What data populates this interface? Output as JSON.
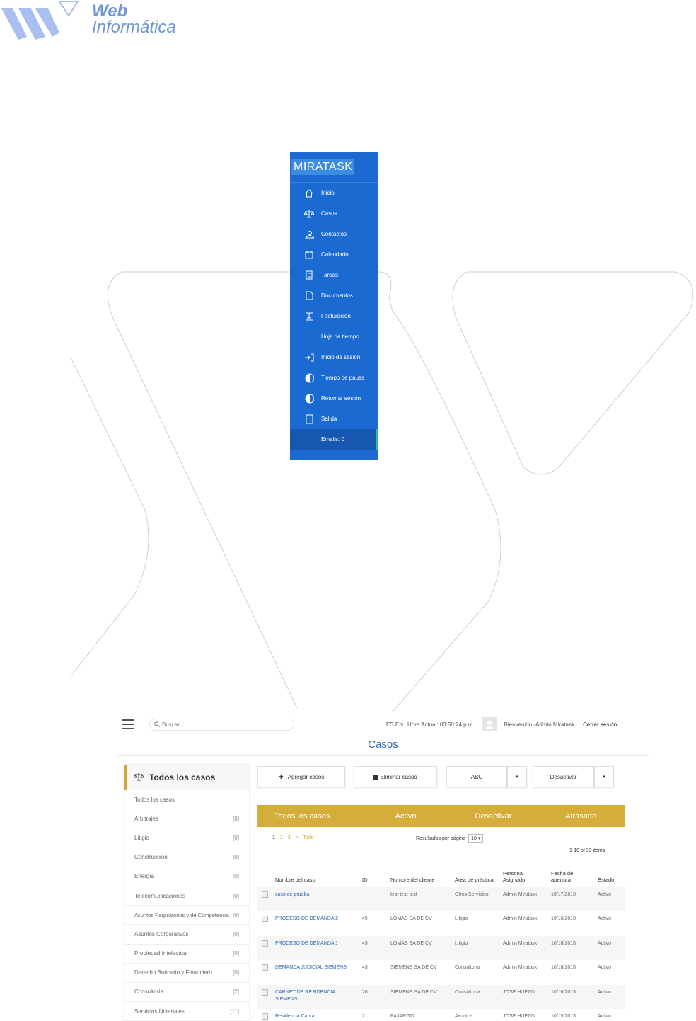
{
  "logo": {
    "line1": "Web",
    "line2": "Informática"
  },
  "sidebar": {
    "brand": "MIRATASK",
    "items": [
      {
        "label": "Inicio",
        "icon": "home-icon"
      },
      {
        "label": "Casos",
        "icon": "scales-icon"
      },
      {
        "label": "Contactos",
        "icon": "contacts-icon"
      },
      {
        "label": "Calendario",
        "icon": "calendar-icon"
      },
      {
        "label": "Tareas",
        "icon": "tasks-icon"
      },
      {
        "label": "Documentos",
        "icon": "document-icon"
      },
      {
        "label": "Facturacion",
        "icon": "invoice-icon"
      },
      {
        "label": "Hoja de tiempo",
        "icon": ""
      },
      {
        "label": "Inicio de sesión",
        "icon": "login-icon"
      },
      {
        "label": "Tiempo de pausa",
        "icon": "pause-icon"
      },
      {
        "label": "Retomar sesión",
        "icon": "resume-icon"
      },
      {
        "label": "Salida",
        "icon": "exit-icon"
      },
      {
        "label": "Emails: 0",
        "icon": ""
      }
    ]
  },
  "topbar": {
    "search_placeholder": "Buscar",
    "lang": "ES  EN",
    "clock": "Hora Actual: 03:50:24 p.m",
    "welcome": "Bienvenido -Admin Miratask",
    "logout": "Cerrar sesión"
  },
  "page_title": "Casos",
  "left_panel": {
    "title": "Todos los casos",
    "rows": [
      {
        "label": "Todos los casos",
        "count": ""
      },
      {
        "label": "Arbitrajes",
        "count": "[0]"
      },
      {
        "label": "Litigio",
        "count": "[0]"
      },
      {
        "label": "Construcción",
        "count": "[0]"
      },
      {
        "label": "Energía",
        "count": "[0]"
      },
      {
        "label": "Telecomunicaciones",
        "count": "[0]"
      },
      {
        "label": "Asuntos Regulatorios y de Competencia",
        "count": "[0]"
      },
      {
        "label": "Asuntos Corporativos",
        "count": "[0]"
      },
      {
        "label": "Propiedad Intelectual",
        "count": "[0]"
      },
      {
        "label": "Derecho Bancario y Financiero",
        "count": "[0]"
      },
      {
        "label": "Consultoría",
        "count": "[2]"
      },
      {
        "label": "Servicios Notariales",
        "count": "[11]"
      }
    ]
  },
  "buttons": {
    "add": "Agregar casos",
    "delete": "Eliminar casos",
    "sort": "ABC",
    "deactivate": "Desactivar"
  },
  "tabs": [
    "Todos los casos",
    "Activo",
    "Desactivar",
    "Atrasado"
  ],
  "pager": {
    "pages": [
      "1",
      "2",
      "3",
      ">",
      "Todo"
    ],
    "per_page_label": "Resultados por página",
    "per_page": "10",
    "range": "1-10 of 33 items"
  },
  "table": {
    "headers": [
      "Nombre del caso",
      "ID",
      "Nombre del cliente",
      "Área de práctica",
      "Personal Asignado",
      "Fecha de apertura",
      "Estado"
    ],
    "rows": [
      [
        "caso de prueba",
        "",
        "test test test",
        "Otros Servicios",
        "Admin Miratask",
        "10/17/2018",
        "Activo"
      ],
      [
        "PROCESO DE DEMANDA 2",
        "45",
        "LOMAS SA DE CV",
        "Litigio",
        "Admin Miratask",
        "10/16/2018",
        "Activo"
      ],
      [
        "PROCESO DE DEMANDA 1",
        "45",
        "LOMAS SA DE CV",
        "Litigio",
        "Admin Miratask",
        "10/16/2018",
        "Activo"
      ],
      [
        "DEMANDA JUDICIAL SIEMENS",
        "43",
        "SIEMENS SA DE CV",
        "Consultoría",
        "Admin Miratask",
        "10/16/2018",
        "Activo"
      ],
      [
        "CARNET DE RESIDENCIA SIEMENS",
        "26",
        "SIEMENS SA DE CV",
        "Consultoría",
        "JOSE HUEZO",
        "10/16/2018",
        "Activo"
      ],
      [
        "Residencia Cabral",
        "2",
        "PAJARITO",
        "Asuntos",
        "JOSE HUEZO",
        "10/15/2018",
        "Activo"
      ]
    ]
  }
}
